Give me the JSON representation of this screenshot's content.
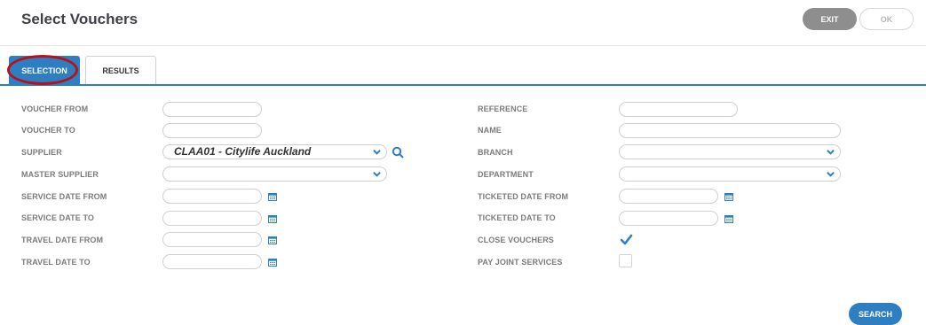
{
  "header": {
    "title": "Select Vouchers",
    "exit_label": "EXIT",
    "ok_label": "OK"
  },
  "tabs": [
    {
      "label": "SELECTION",
      "active": true
    },
    {
      "label": "RESULTS",
      "active": false
    }
  ],
  "left_form": {
    "voucher_from": {
      "label": "VOUCHER FROM",
      "value": ""
    },
    "voucher_to": {
      "label": "VOUCHER TO",
      "value": ""
    },
    "supplier": {
      "label": "SUPPLIER",
      "value": "CLAA01 - Citylife Auckland"
    },
    "master_supplier": {
      "label": "MASTER SUPPLIER",
      "value": ""
    },
    "service_date_from": {
      "label": "SERVICE DATE FROM",
      "value": ""
    },
    "service_date_to": {
      "label": "SERVICE DATE TO",
      "value": ""
    },
    "travel_date_from": {
      "label": "TRAVEL DATE FROM",
      "value": ""
    },
    "travel_date_to": {
      "label": "TRAVEL DATE TO",
      "value": ""
    }
  },
  "right_form": {
    "reference": {
      "label": "REFERENCE",
      "value": ""
    },
    "name": {
      "label": "NAME",
      "value": ""
    },
    "branch": {
      "label": "BRANCH",
      "value": ""
    },
    "department": {
      "label": "DEPARTMENT",
      "value": ""
    },
    "ticketed_date_from": {
      "label": "TICKETED DATE FROM",
      "value": ""
    },
    "ticketed_date_to": {
      "label": "TICKETED DATE TO",
      "value": ""
    },
    "close_vouchers": {
      "label": "CLOSE VOUCHERS",
      "checked": true
    },
    "pay_joint_services": {
      "label": "PAY JOINT SERVICES",
      "checked": false
    }
  },
  "search_label": "SEARCH",
  "colors": {
    "accent": "#2e7fc2",
    "exit_button": "#8e8e8e",
    "annotation": "#b5121b"
  }
}
